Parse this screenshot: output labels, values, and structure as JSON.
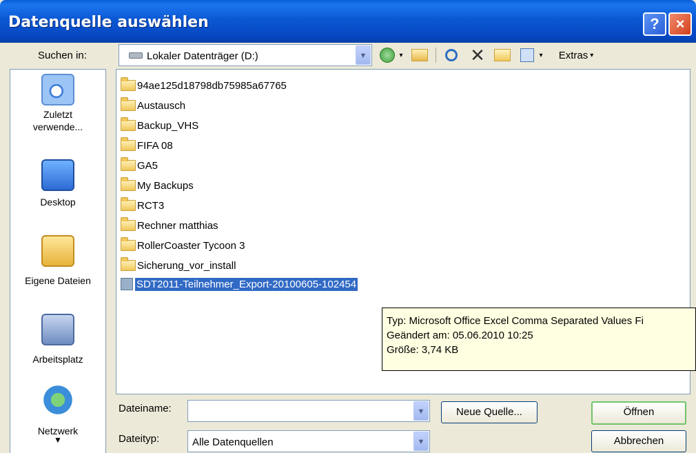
{
  "window": {
    "title": "Datenquelle auswählen",
    "help": "?",
    "close": "×"
  },
  "lookin": {
    "label": "Suchen in:",
    "value": "Lokaler Datenträger (D:)"
  },
  "toolbar": {
    "extras": "Extras"
  },
  "places": [
    {
      "label": "Zuletzt verwende...",
      "icon": "recent-documents-icon"
    },
    {
      "label": "Desktop",
      "icon": "desktop-icon"
    },
    {
      "label": "Eigene Dateien",
      "icon": "my-documents-icon"
    },
    {
      "label": "Arbeitsplatz",
      "icon": "my-computer-icon"
    },
    {
      "label": "Netzwerk",
      "icon": "network-icon"
    }
  ],
  "files": [
    {
      "name": "94ae125d18798db75985a67765",
      "type": "folder"
    },
    {
      "name": "Austausch",
      "type": "folder"
    },
    {
      "name": "Backup_VHS",
      "type": "folder"
    },
    {
      "name": "FIFA 08",
      "type": "folder"
    },
    {
      "name": "GA5",
      "type": "folder"
    },
    {
      "name": "My Backups",
      "type": "folder"
    },
    {
      "name": "RCT3",
      "type": "folder"
    },
    {
      "name": "Rechner matthias",
      "type": "folder"
    },
    {
      "name": "RollerCoaster Tycoon 3",
      "type": "folder"
    },
    {
      "name": "Sicherung_vor_install",
      "type": "folder"
    },
    {
      "name": "SDT2011-Teilnehmer_Export-20100605-102454",
      "type": "file",
      "selected": true
    }
  ],
  "tooltip": {
    "type": "Typ: Microsoft Office Excel Comma Separated Values Fi",
    "modified": "Geändert am: 05.06.2010 10:25",
    "size": "Größe: 3,74 KB"
  },
  "filename": {
    "label": "Dateiname:",
    "value": ""
  },
  "filetype": {
    "label": "Dateityp:",
    "value": "Alle Datenquellen"
  },
  "buttons": {
    "new_source": "Neue Quelle...",
    "open": "Öffnen",
    "cancel": "Abbrechen"
  }
}
